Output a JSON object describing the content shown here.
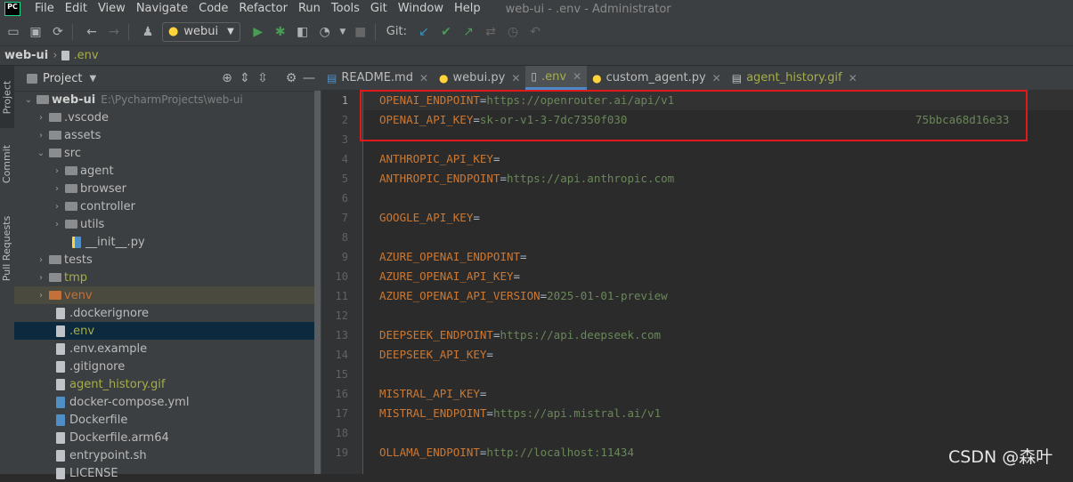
{
  "window": {
    "title": "web-ui - .env - Administrator",
    "menu": [
      "File",
      "Edit",
      "View",
      "Navigate",
      "Code",
      "Refactor",
      "Run",
      "Tools",
      "Git",
      "Window",
      "Help"
    ]
  },
  "toolbar": {
    "run_config": "webui",
    "git_label": "Git:"
  },
  "breadcrumb": {
    "project": "web-ui",
    "file": ".env"
  },
  "tool_strip": [
    "Project",
    "Commit",
    "Pull Requests"
  ],
  "project_panel": {
    "title": "Project",
    "tree": [
      {
        "label": "web-ui",
        "path": "E:\\PycharmProjects\\web-ui"
      },
      {
        "label": ".vscode"
      },
      {
        "label": "assets"
      },
      {
        "label": "src"
      },
      {
        "label": "agent"
      },
      {
        "label": "browser"
      },
      {
        "label": "controller"
      },
      {
        "label": "utils"
      },
      {
        "label": "__init__.py"
      },
      {
        "label": "tests"
      },
      {
        "label": "tmp"
      },
      {
        "label": "venv"
      },
      {
        "label": ".dockerignore"
      },
      {
        "label": ".env"
      },
      {
        "label": ".env.example"
      },
      {
        "label": ".gitignore"
      },
      {
        "label": "agent_history.gif"
      },
      {
        "label": "docker-compose.yml"
      },
      {
        "label": "Dockerfile"
      },
      {
        "label": "Dockerfile.arm64"
      },
      {
        "label": "entrypoint.sh"
      },
      {
        "label": "LICENSE"
      }
    ]
  },
  "editor": {
    "tabs": [
      {
        "label": "README.md"
      },
      {
        "label": "webui.py"
      },
      {
        "label": ".env"
      },
      {
        "label": "custom_agent.py"
      },
      {
        "label": "agent_history.gif"
      }
    ],
    "line_numbers": [
      "1",
      "2",
      "3",
      "4",
      "5",
      "6",
      "7",
      "8",
      "9",
      "10",
      "11",
      "12",
      "13",
      "14",
      "15",
      "16",
      "17",
      "18",
      "19"
    ],
    "lines": [
      {
        "key": "OPENAI_ENDPOINT",
        "value": "https://openrouter.ai/api/v1"
      },
      {
        "key": "OPENAI_API_KEY",
        "value": "sk-or-v1-3-7dc7350f030                                           75bbca68d16e33"
      },
      {
        "key": "",
        "value": ""
      },
      {
        "key": "ANTHROPIC_API_KEY",
        "value": ""
      },
      {
        "key": "ANTHROPIC_ENDPOINT",
        "value": "https://api.anthropic.com"
      },
      {
        "key": "",
        "value": ""
      },
      {
        "key": "GOOGLE_API_KEY",
        "value": ""
      },
      {
        "key": "",
        "value": ""
      },
      {
        "key": "AZURE_OPENAI_ENDPOINT",
        "value": ""
      },
      {
        "key": "AZURE_OPENAI_API_KEY",
        "value": ""
      },
      {
        "key": "AZURE_OPENAI_API_VERSION",
        "value": "2025-01-01-preview"
      },
      {
        "key": "",
        "value": ""
      },
      {
        "key": "DEEPSEEK_ENDPOINT",
        "value": "https://api.deepseek.com"
      },
      {
        "key": "DEEPSEEK_API_KEY",
        "value": ""
      },
      {
        "key": "",
        "value": ""
      },
      {
        "key": "MISTRAL_API_KEY",
        "value": ""
      },
      {
        "key": "MISTRAL_ENDPOINT",
        "value": "https://api.mistral.ai/v1"
      },
      {
        "key": "",
        "value": ""
      },
      {
        "key": "OLLAMA_ENDPOINT",
        "value": "http://localhost:11434"
      }
    ]
  },
  "watermark": "CSDN @森叶",
  "colors": {
    "highlight_box": "#e01a1a",
    "selected_row": "#0d293e",
    "key": "#cc7832",
    "value": "#6a8759"
  }
}
